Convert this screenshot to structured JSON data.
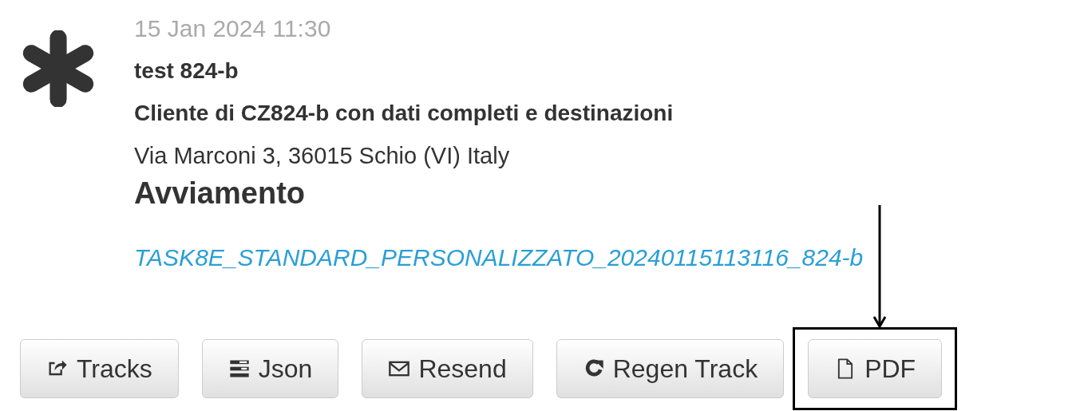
{
  "entry": {
    "date": "15 Jan 2024 11:30",
    "name": "test 824-b",
    "customer": "Cliente di CZ824-b con dati completi e destinazioni",
    "address": "Via Marconi 3, 36015 Schio (VI) Italy",
    "status": "Avviamento",
    "task_link": "TASK8E_STANDARD_PERSONALIZZATO_20240115113116_824-b"
  },
  "buttons": [
    {
      "label": "Tracks",
      "kind": "share",
      "highlighted": false
    },
    {
      "label": "Json",
      "kind": "list",
      "highlighted": false
    },
    {
      "label": "Resend",
      "kind": "mail",
      "highlighted": false
    },
    {
      "label": "Regen Track",
      "kind": "refresh",
      "highlighted": false
    },
    {
      "label": "PDF",
      "kind": "file",
      "highlighted": true
    }
  ]
}
